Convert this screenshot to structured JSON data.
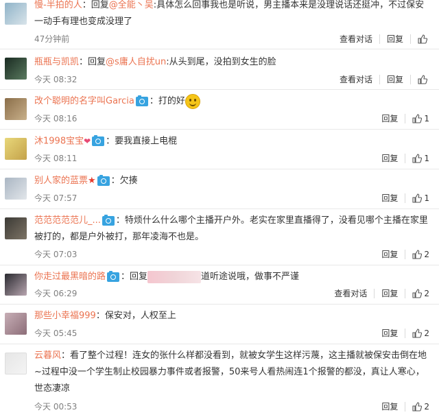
{
  "comments": [
    {
      "user": "慢-半拍的人",
      "body": "：回复",
      "at": "@全能丶吴",
      "rest": ":具体怎么回事我也是听说，男主播本来是没理说话还挺冲，不过保安一动手有理也变成没理了",
      "time": "47分钟前",
      "view": "查看对话",
      "reply": "回复",
      "likes": ""
    },
    {
      "user": "瓶瓶与凯凯",
      "body": "：回复",
      "at": "@s庸人自扰un",
      "rest": ":从头到尾，没拍到女生的脸",
      "time": "今天 08:32",
      "view": "查看对话",
      "reply": "回复",
      "likes": ""
    },
    {
      "user": "改个聪明的名字叫Garcia",
      "body": "：打的好",
      "time": "今天 08:16",
      "reply": "回复",
      "likes": "1"
    },
    {
      "user": "沐1998宝宝",
      "body": "：要我直接上电棍",
      "time": "今天 08:11",
      "reply": "回复",
      "likes": "1"
    },
    {
      "user": "别人家的蓝票",
      "body": "：欠揍",
      "time": "今天 07:57",
      "reply": "回复",
      "likes": "1"
    },
    {
      "user": "范范范范范儿_...",
      "body": "：特烦什么什么哪个主播开户外。老实在家里直播得了，没看见哪个主播在家里被打的，都是户外被打，那年凌海不也是。",
      "time": "今天 07:03",
      "reply": "回复",
      "likes": "2"
    },
    {
      "user": "你走过最黑暗的路",
      "body": "：回复",
      "rest": "道听途说哦，做事不严谨",
      "time": "今天 06:29",
      "view": "查看对话",
      "reply": "回复",
      "likes": "2"
    },
    {
      "user": "那些小幸福999",
      "body": "：保安对，人权至上",
      "time": "今天 05:45",
      "reply": "回复",
      "likes": "2"
    },
    {
      "user": "云暮风",
      "body": "：看了整个过程！连女的张什么样都没看到，就被女学生这样污蔑，这主播就被保安击倒在地~过程中没一个学生制止校园暴力事件或者报警，50来号人看热闹连1个报警的都没，真让人寒心，世态凄凉",
      "time": "今天 00:53",
      "reply": "回复",
      "likes": "2"
    }
  ],
  "colors": {
    "username": "#eb7350",
    "meta": "#808080",
    "badge": "#37a3e0"
  }
}
